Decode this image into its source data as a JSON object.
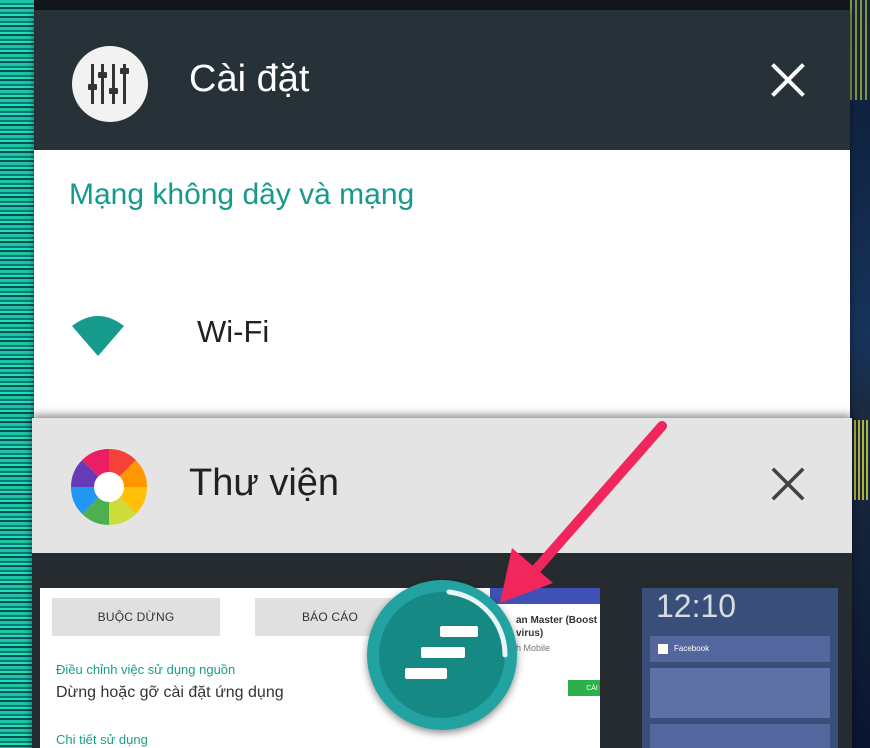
{
  "settings_card": {
    "title": "Cài đặt",
    "icon": "equalizer-sliders-icon",
    "section_heading": "Mạng không dây và mạng",
    "wifi_label": "Wi-Fi",
    "header_color": "#263238",
    "accent_color": "#159a8c"
  },
  "gallery_card": {
    "title": "Thư viện",
    "icon": "color-wheel-icon",
    "header_color": "#e4e4e4"
  },
  "thumbnail_app": {
    "force_stop_label": "BUỘC DỪNG",
    "report_label": "BÁO CÁO",
    "battery_heading": "Điều chỉnh việc sử dụng nguồn",
    "battery_desc": "Dừng hoặc gỡ cài đặt ứng dụng",
    "usage_heading": "Chi tiết sử dụng",
    "inner_card_title": "an Master (Boost\nvirus)",
    "inner_card_sub": "h Mobile",
    "install_label": "CÀI ĐẶT"
  },
  "thumbnail_lock": {
    "clock": "12:10",
    "notif_1": "Facebook"
  },
  "overlay": {
    "floating_button_icon": "stacked-bars-icon",
    "arrow_color": "#f0265c",
    "fab_color": "#22a2a0"
  }
}
